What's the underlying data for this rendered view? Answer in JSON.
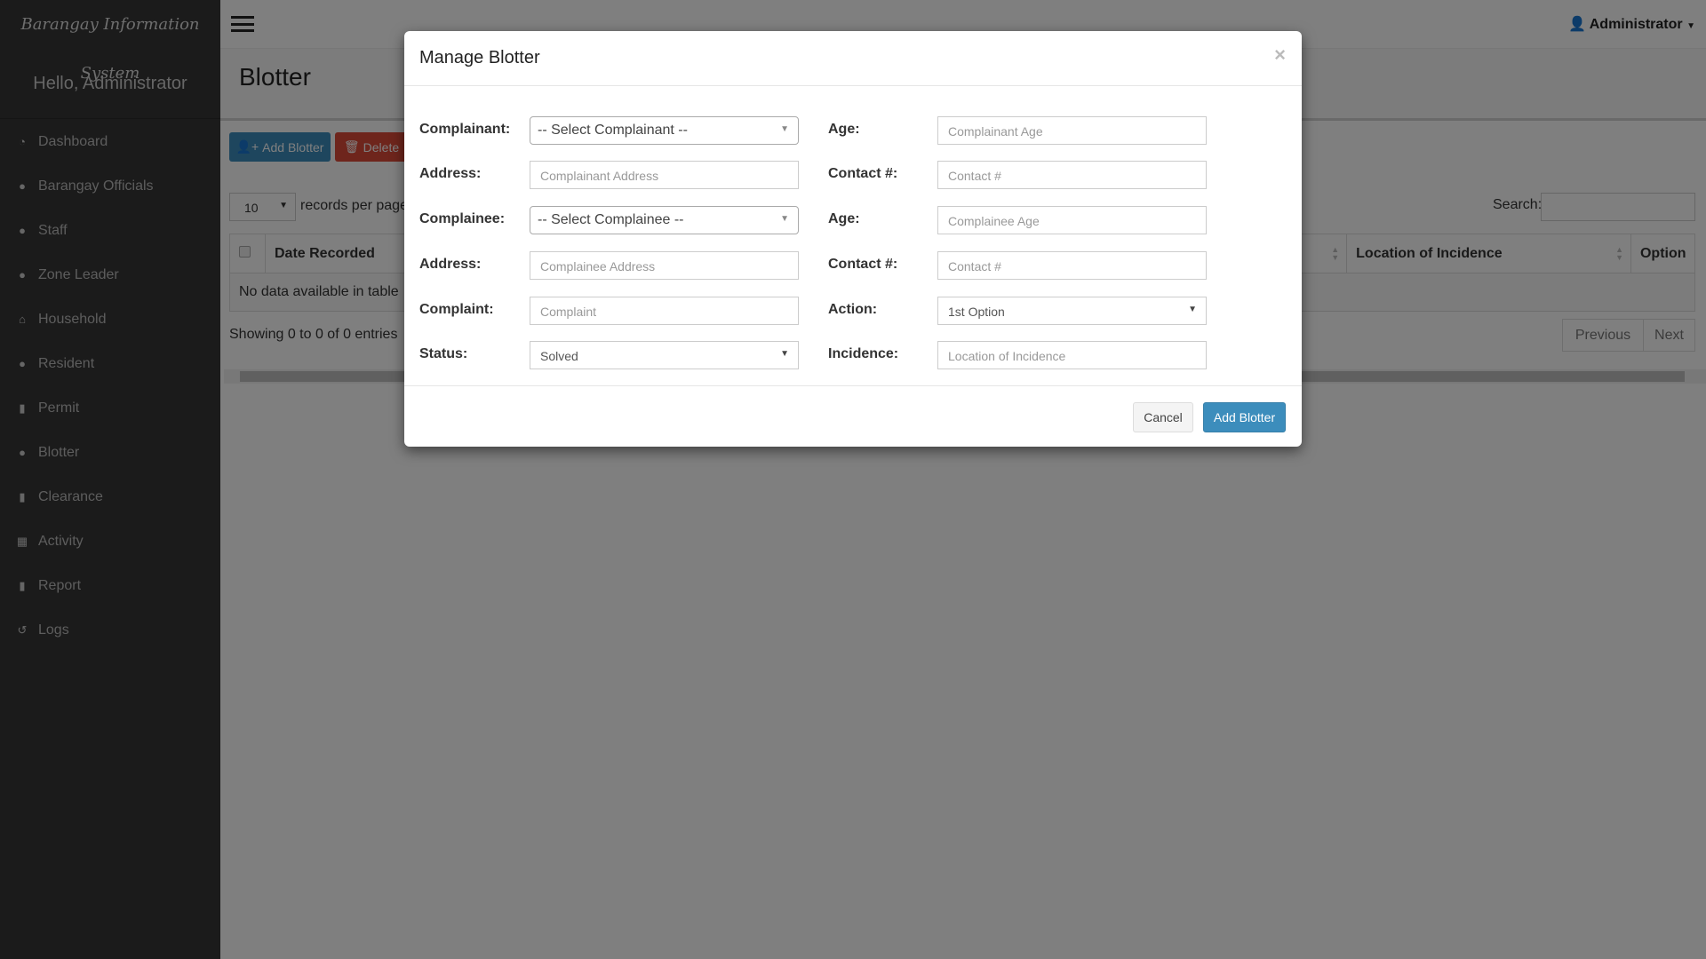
{
  "app": {
    "brand": "Barangay Information System",
    "greeting": "Hello, Administrator",
    "user": "Administrator"
  },
  "sidebar": {
    "items": [
      {
        "label": "Dashboard",
        "icon": "dashboard-icon",
        "glyph": "◔"
      },
      {
        "label": "Barangay Officials",
        "icon": "user-icon",
        "glyph": "●"
      },
      {
        "label": "Staff",
        "icon": "user-icon",
        "glyph": "●"
      },
      {
        "label": "Zone Leader",
        "icon": "user-icon",
        "glyph": "●"
      },
      {
        "label": "Household",
        "icon": "home-icon",
        "glyph": "⌂"
      },
      {
        "label": "Resident",
        "icon": "users-icon",
        "glyph": "●"
      },
      {
        "label": "Permit",
        "icon": "file-icon",
        "glyph": "▮"
      },
      {
        "label": "Blotter",
        "icon": "users-icon",
        "glyph": "●"
      },
      {
        "label": "Clearance",
        "icon": "file-icon",
        "glyph": "▮"
      },
      {
        "label": "Activity",
        "icon": "calendar-icon",
        "glyph": "▦"
      },
      {
        "label": "Report",
        "icon": "file-icon",
        "glyph": "▮"
      },
      {
        "label": "Logs",
        "icon": "history-icon",
        "glyph": "↺"
      }
    ]
  },
  "page": {
    "title": "Blotter",
    "add_label": "Add Blotter",
    "delete_label": "Delete",
    "length_value": "10",
    "length_label": "records per page",
    "search_label": "Search:",
    "table": {
      "headers": [
        "Date Recorded",
        "Location of Incidence",
        "Option"
      ],
      "empty": "No data available in table"
    },
    "info": "Showing 0 to 0 of 0 entries",
    "prev": "Previous",
    "next": "Next"
  },
  "modal": {
    "title": "Manage Blotter",
    "close": "×",
    "left": [
      {
        "label": "Complainant:",
        "value": "-- Select Complainant --",
        "type": "select2"
      },
      {
        "label": "Address:",
        "placeholder": "Complainant Address",
        "type": "input"
      },
      {
        "label": "Complainee:",
        "value": "-- Select Complainee --",
        "type": "select2"
      },
      {
        "label": "Address:",
        "placeholder": "Complainee Address",
        "type": "input"
      },
      {
        "label": "Complaint:",
        "placeholder": "Complaint",
        "type": "input"
      },
      {
        "label": "Status:",
        "value": "Solved",
        "type": "select"
      }
    ],
    "right": [
      {
        "label": "Age:",
        "placeholder": "Complainant Age"
      },
      {
        "label": "Contact #:",
        "placeholder": "Contact #"
      },
      {
        "label": "Age:",
        "placeholder": "Complainee Age"
      },
      {
        "label": "Contact #:",
        "placeholder": "Contact #"
      },
      {
        "label": "Action:",
        "value": "1st Option",
        "type": "select"
      },
      {
        "label": "Incidence:",
        "placeholder": "Location of Incidence"
      }
    ],
    "cancel": "Cancel",
    "submit": "Add Blotter"
  },
  "colors": {
    "primary": "#3c8dbc",
    "danger": "#dd4b39",
    "sidebar": "#363636"
  }
}
